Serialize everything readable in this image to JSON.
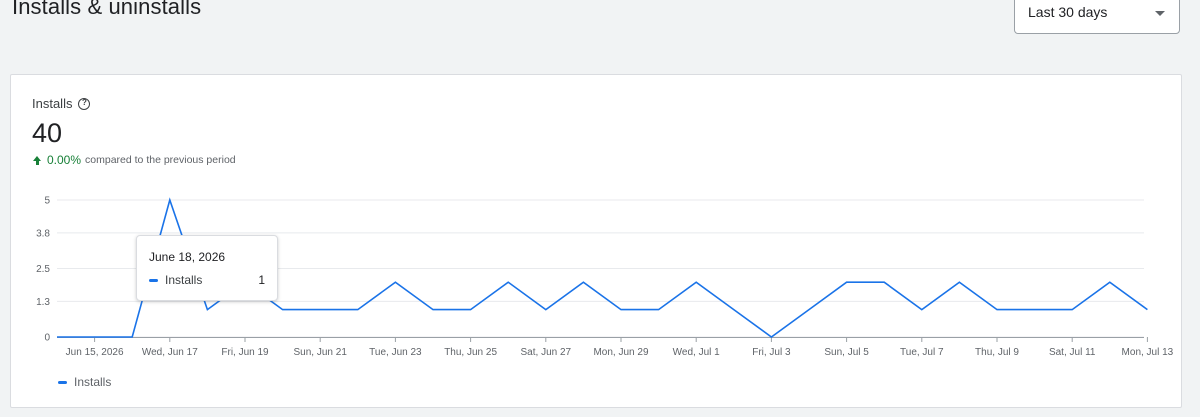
{
  "page": {
    "title": "Installs & uninstalls"
  },
  "range_select": {
    "label": "Last 30 days",
    "icon": "dropdown-arrow-icon"
  },
  "metric": {
    "title": "Installs",
    "value": "40",
    "change": "0.00%",
    "change_text": "compared to the previous period",
    "help_icon": "help-circle-icon",
    "change_icon": "arrow-up-icon"
  },
  "tooltip": {
    "date": "June 18, 2026",
    "series": "Installs",
    "value": "1"
  },
  "colors": {
    "series": "#1a73e8",
    "positive": "#188038",
    "grid": "#e8eaed"
  },
  "chart_data": {
    "type": "line",
    "ylim": [
      0,
      5
    ],
    "y_ticks": [
      "0",
      "1.3",
      "2.5",
      "3.8",
      "5"
    ],
    "x_tick_labels": [
      "Jun 15, 2026",
      "Wed, Jun 17",
      "Fri, Jun 19",
      "Sun, Jun 21",
      "Tue, Jun 23",
      "Thu, Jun 25",
      "Sat, Jun 27",
      "Mon, Jun 29",
      "Wed, Jul 1",
      "Fri, Jul 3",
      "Sun, Jul 5",
      "Tue, Jul 7",
      "Thu, Jul 9",
      "Sat, Jul 11",
      "Mon, Jul 13"
    ],
    "x": [
      "Jun 14",
      "Jun 15",
      "Jun 16",
      "Jun 17",
      "Jun 18",
      "Jun 19",
      "Jun 20",
      "Jun 21",
      "Jun 22",
      "Jun 23",
      "Jun 24",
      "Jun 25",
      "Jun 26",
      "Jun 27",
      "Jun 28",
      "Jun 29",
      "Jun 30",
      "Jul 1",
      "Jul 2",
      "Jul 3",
      "Jul 4",
      "Jul 5",
      "Jul 6",
      "Jul 7",
      "Jul 8",
      "Jul 9",
      "Jul 10",
      "Jul 11",
      "Jul 12",
      "Jul 13"
    ],
    "series": [
      {
        "name": "Installs",
        "values": [
          0,
          0,
          0,
          5,
          1,
          2,
          1,
          1,
          1,
          2,
          1,
          1,
          2,
          1,
          2,
          1,
          1,
          2,
          1,
          0,
          1,
          2,
          2,
          1,
          2,
          1,
          1,
          1,
          2,
          1
        ]
      }
    ],
    "legend": "bottom-left",
    "grid": true
  }
}
